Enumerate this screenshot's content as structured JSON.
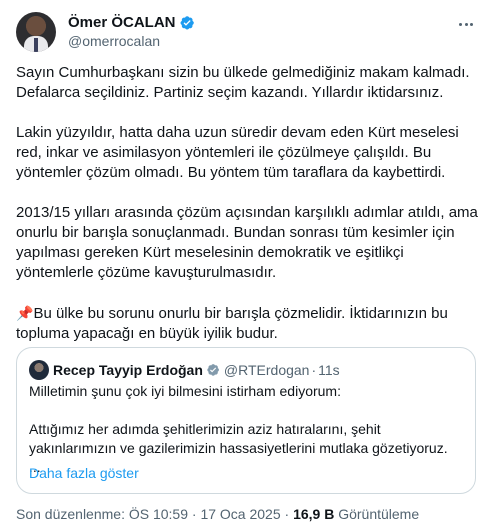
{
  "author": {
    "display_name": "Ömer ÖCALAN",
    "handle": "@omerrocalan"
  },
  "tweet": {
    "paragraphs": [
      "Sayın Cumhurbaşkanı sizin bu ülkede gelmediğiniz makam kalmadı. Defalarca seçildiniz. Partiniz seçim kazandı. Yıllardır iktidarsınız.",
      "Lakin yüzyıldır, hatta daha uzun süredir devam eden Kürt meselesi red, inkar ve asimilasyon yöntemleri ile çözülmeye çalışıldı. Bu yöntemler çözüm olmadı. Bu yöntem tüm taraflara da kaybettirdi.",
      "2013/15 yılları arasında çözüm açısından karşılıklı adımlar atıldı, ama onurlu bir barışla sonuçlanmadı. Bundan sonrası tüm kesimler için yapılması gereken Kürt meselesinin demokratik ve eşitlikçi yöntemlerle çözüme kavuşturulmasıdır."
    ],
    "pin_emoji": "📌",
    "last_paragraph": "Bu ülke bu sorunu onurlu bir barışla çözmelidir. İktidarınızın bu topluma yapacağı en büyük iyilik budur."
  },
  "quote": {
    "display_name": "Recep Tayyip Erdoğan",
    "handle": "@RTErdogan",
    "separator": "·",
    "time": "11s",
    "line1": "Milletimin şunu çok iyi bilmesini istirham ediyorum:",
    "line2": "Attığımız her adımda şehitlerimizin aziz hatıralarını, şehit yakınlarımızın ve gazilerimizin hassasiyetlerini mutlaka gözetiyoruz.",
    "ellipsis": "...",
    "show_more": "Daha fazla göster"
  },
  "footer": {
    "edited": "Son düzenlenme: ÖS 10:59 · 17 Oca 2025 ·",
    "views_count": "16,9 B",
    "views_label": "Görüntüleme"
  },
  "colors": {
    "verified": "#1d9bf0",
    "link": "#1d9bf0",
    "muted": "#536471",
    "text": "#0f1419",
    "border": "#cfd9de"
  },
  "icons": {
    "verified": "verified-badge-icon",
    "more": "more-horizontal-icon",
    "pin": "pushpin-icon"
  }
}
